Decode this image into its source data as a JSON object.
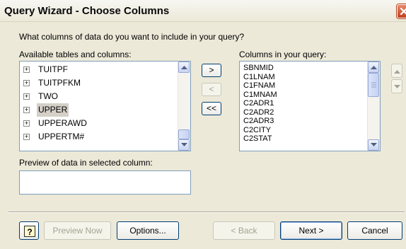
{
  "window": {
    "title": "Query Wizard - Choose Columns"
  },
  "prompt": "What columns of data do you want to include in your query?",
  "available": {
    "label": "Available tables and columns:",
    "items": [
      {
        "text": "TUITPF",
        "expander": "+"
      },
      {
        "text": "TUITPFKM",
        "expander": "+"
      },
      {
        "text": "TWO",
        "expander": "+"
      },
      {
        "text": "UPPER",
        "expander": "+",
        "selected": true
      },
      {
        "text": "UPPERAWD",
        "expander": "+"
      },
      {
        "text": "UPPERTM#",
        "expander": "+"
      }
    ]
  },
  "transfer_buttons": {
    "add": ">",
    "remove": "<",
    "remove_all": "<<"
  },
  "query_columns": {
    "label": "Columns in your query:",
    "items": [
      "SBNMID",
      "C1LNAM",
      "C1FNAM",
      "C1MNAM",
      "C2ADR1",
      "C2ADR2",
      "C2ADR3",
      "C2CITY",
      "C2STAT"
    ]
  },
  "preview": {
    "label": "Preview of data in selected column:",
    "value": ""
  },
  "footer": {
    "help_glyph": "?",
    "preview_now": "Preview Now",
    "options": "Options...",
    "back": "< Back",
    "next": "Next >",
    "cancel": "Cancel"
  },
  "icons": [
    "close-icon",
    "help-icon",
    "up-arrow-icon",
    "down-arrow-icon",
    "plus-icon"
  ],
  "colors": {
    "window_bg": "#ece9d8",
    "list_border": "#7f9db9",
    "close_red": "#c0401f",
    "selection": "#d4d0c8"
  }
}
